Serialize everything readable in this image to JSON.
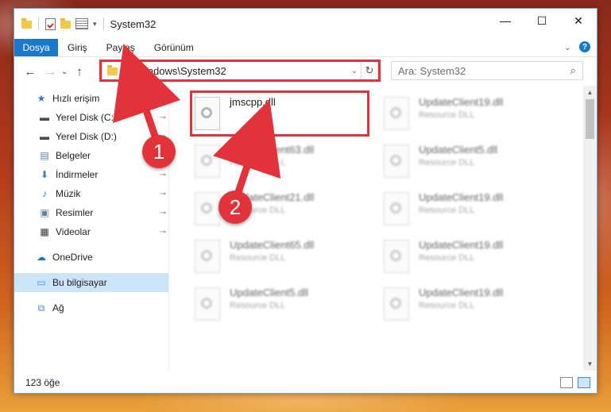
{
  "window": {
    "title": "System32",
    "controls": {
      "minimize": "—",
      "maximize": "☐",
      "close": "✕"
    }
  },
  "ribbon": {
    "file_tab": "Dosya",
    "tabs": [
      "Giriş",
      "Paylaş",
      "Görünüm"
    ],
    "help_icon": "?",
    "collapse_icon": "⌄"
  },
  "navigation": {
    "back": "←",
    "forward": "→",
    "recent": "⌄",
    "up": "↑"
  },
  "address_bar": {
    "path": "C:\\Windows\\System32",
    "dropdown": "⌄",
    "refresh": "↻"
  },
  "search": {
    "placeholder": "Ara: System32",
    "icon": "⌕"
  },
  "sidebar": {
    "items": [
      {
        "label": "Hızlı erişim",
        "icon": "★",
        "pinned": false,
        "color": "#2e7ad1"
      },
      {
        "label": "Yerel Disk (C:)",
        "icon": "▬",
        "pinned": true,
        "color": "#4a4a4a"
      },
      {
        "label": "Yerel Disk (D:)",
        "icon": "▬",
        "pinned": true,
        "color": "#4a4a4a"
      },
      {
        "label": "Belgeler",
        "icon": "▤",
        "pinned": true,
        "color": "#5b7fa6"
      },
      {
        "label": "İndirmeler",
        "icon": "⬇",
        "pinned": true,
        "color": "#2e7ad1"
      },
      {
        "label": "Müzik",
        "icon": "♪",
        "pinned": true,
        "color": "#2e7ad1"
      },
      {
        "label": "Resimler",
        "icon": "▣",
        "pinned": true,
        "color": "#5b7fa6"
      },
      {
        "label": "Videolar",
        "icon": "▦",
        "pinned": true,
        "color": "#333333"
      },
      {
        "label": "OneDrive",
        "icon": "☁",
        "pinned": false,
        "color": "#1979ca"
      },
      {
        "label": "Bu bilgisayar",
        "icon": "▭",
        "pinned": false,
        "color": "#3d8ee0"
      },
      {
        "label": "Ağ",
        "icon": "⧉",
        "pinned": false,
        "color": "#3d8ee0"
      }
    ],
    "pin_icon": "📌"
  },
  "files": [
    {
      "name": "jmscpp.dll",
      "type": "",
      "highlighted": true
    },
    {
      "name": "UpdateClient19.dll",
      "type": "Resource DLL"
    },
    {
      "name": "UpdateClient63.dll",
      "type": "Resource DLL"
    },
    {
      "name": "UpdateClient5.dll",
      "type": "Resource DLL"
    },
    {
      "name": "UpdateClient21.dll",
      "type": "Resource DLL"
    },
    {
      "name": "UpdateClient19.dll",
      "type": "Resource DLL"
    },
    {
      "name": "UpdateClient65.dll",
      "type": "Resource DLL"
    },
    {
      "name": "UpdateClient19.dll",
      "type": "Resource DLL"
    },
    {
      "name": "UpdateClient5.dll",
      "type": "Resource DLL"
    },
    {
      "name": "UpdateClient19.dll",
      "type": "Resource DLL"
    }
  ],
  "status": {
    "item_count": "123 öğe"
  },
  "callouts": {
    "one": "1",
    "two": "2"
  },
  "colors": {
    "accent": "#1979ca",
    "highlight": "#e2333a"
  }
}
